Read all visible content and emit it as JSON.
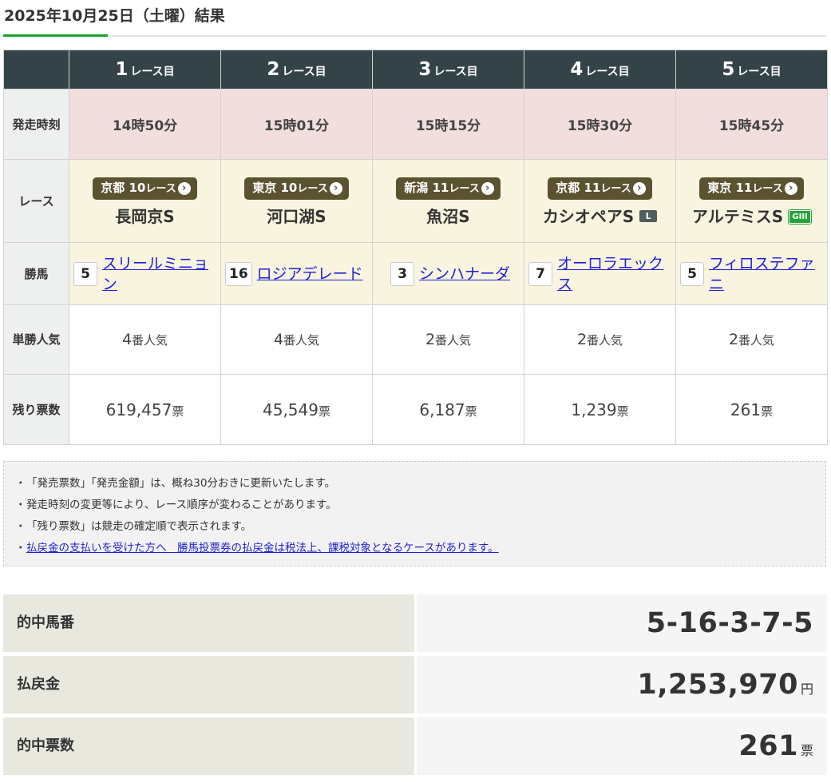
{
  "page_title": "2025年10月25日（土曜）結果",
  "table": {
    "row_labels": {
      "time": "発走時刻",
      "race": "レース",
      "winner": "勝馬",
      "popularity": "単勝人気",
      "remaining": "残り票数"
    },
    "race_suffix": "レース目",
    "races": [
      {
        "num": "1",
        "time": "14時50分",
        "venue": "京都",
        "race_no": "10",
        "race_word": "レース",
        "name": "長岡京S",
        "grade": "",
        "horse_num": "5",
        "horse": "スリールミニョン",
        "pop_num": "4",
        "pop_unit": "番人気",
        "left_num": "619,457",
        "left_unit": "票"
      },
      {
        "num": "2",
        "time": "15時01分",
        "venue": "東京",
        "race_no": "10",
        "race_word": "レース",
        "name": "河口湖S",
        "grade": "",
        "horse_num": "16",
        "horse": "ロジアデレード",
        "pop_num": "4",
        "pop_unit": "番人気",
        "left_num": "45,549",
        "left_unit": "票"
      },
      {
        "num": "3",
        "time": "15時15分",
        "venue": "新潟",
        "race_no": "11",
        "race_word": "レース",
        "name": "魚沼S",
        "grade": "",
        "horse_num": "3",
        "horse": "シンハナーダ",
        "pop_num": "2",
        "pop_unit": "番人気",
        "left_num": "6,187",
        "left_unit": "票"
      },
      {
        "num": "4",
        "time": "15時30分",
        "venue": "京都",
        "race_no": "11",
        "race_word": "レース",
        "name": "カシオペアS",
        "grade": "L",
        "horse_num": "7",
        "horse": "オーロラエックス",
        "pop_num": "2",
        "pop_unit": "番人気",
        "left_num": "1,239",
        "left_unit": "票"
      },
      {
        "num": "5",
        "time": "15時45分",
        "venue": "東京",
        "race_no": "11",
        "race_word": "レース",
        "name": "アルテミスS",
        "grade": "GIII",
        "horse_num": "5",
        "horse": "フィロステファニ",
        "pop_num": "2",
        "pop_unit": "番人気",
        "left_num": "261",
        "left_unit": "票"
      }
    ]
  },
  "notes": [
    "「発売票数」「発売金額」は、概ね30分おきに更新いたします。",
    "発走時刻の変更等により、レース順序が変わることがあります。",
    "「残り票数」は競走の確定順で表示されます。"
  ],
  "notes_link": "払戻金の支払いを受けた方へ　勝馬投票券の払戻金は税法上、課税対象となるケースがあります。",
  "notes_bullet": "・",
  "summary": {
    "numbers_label": "的中馬番",
    "numbers_value": "5-16-3-7-5",
    "payout_label": "払戻金",
    "payout_value": "1,253,970",
    "payout_unit": "円",
    "hits_label": "的中票数",
    "hits_value": "261",
    "hits_unit": "票"
  },
  "colors": {
    "header_bg": "#334348",
    "time_row_bg": "#f3dede",
    "race_row_bg": "#f8f4df",
    "venue_badge": "#5b5230",
    "link": "#1f1fd6",
    "accent": "#1ba037"
  },
  "icons": {
    "badge_arrow": "chevron-circle-right-icon",
    "grade_l": "listed-grade-icon",
    "grade_g3": "g3-grade-icon"
  }
}
